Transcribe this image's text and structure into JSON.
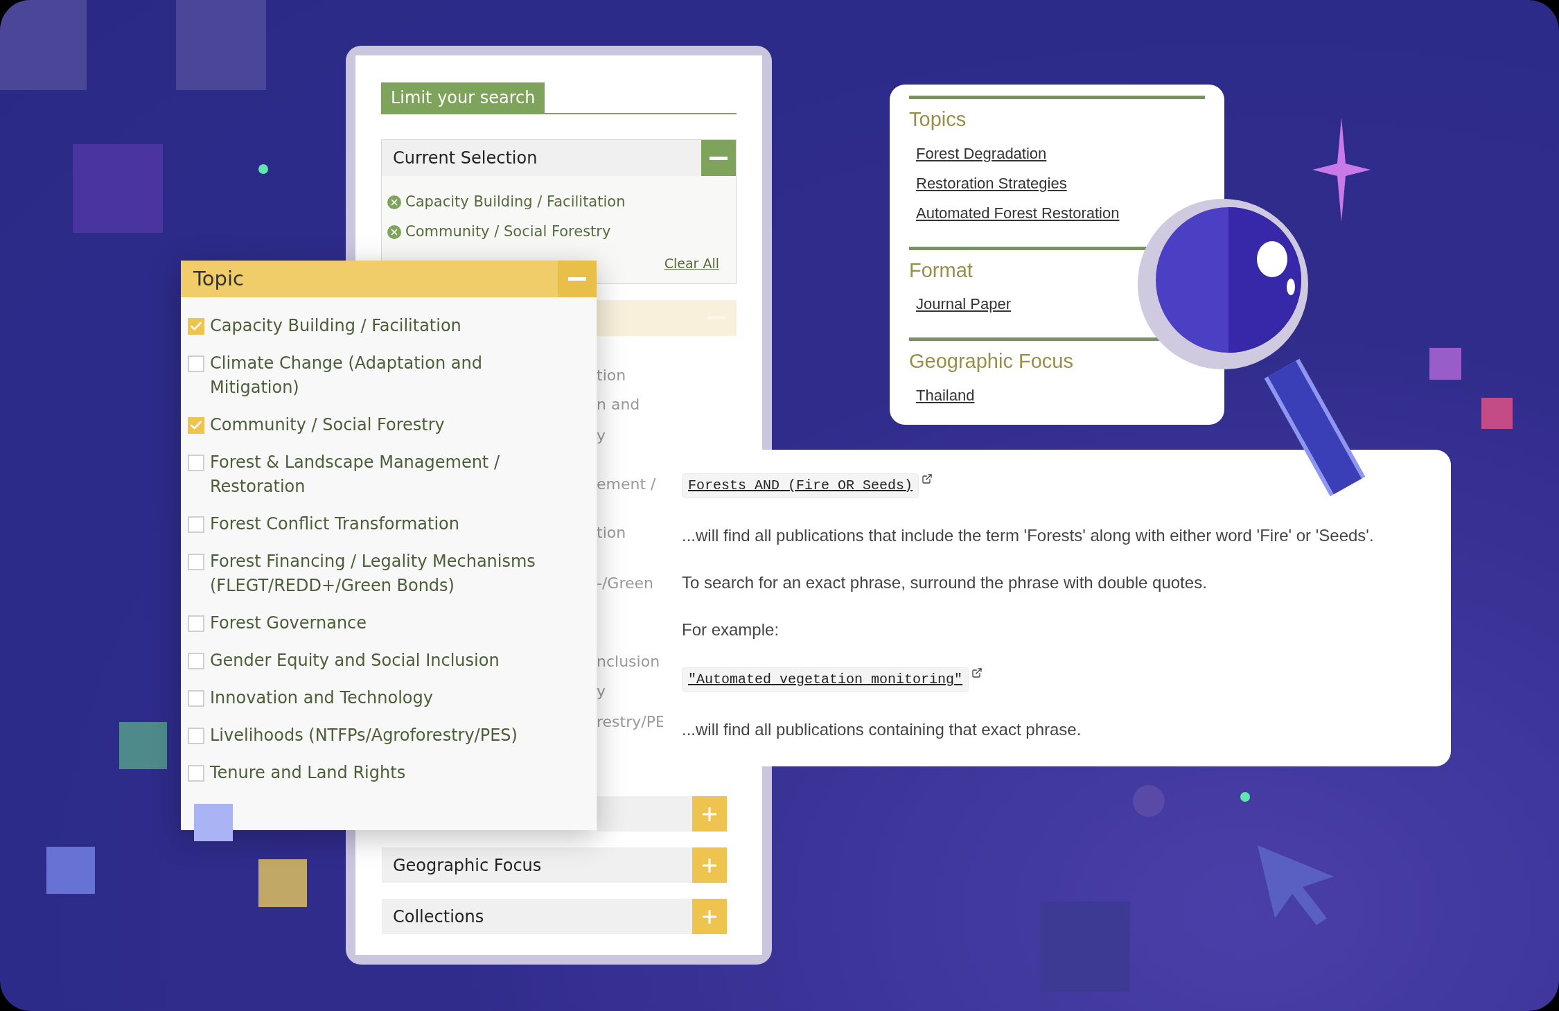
{
  "filter_panel": {
    "title": "Limit your search",
    "current_selection": {
      "title": "Current Selection",
      "expanded": true,
      "items": [
        "Capacity Building / Facilitation",
        "Community / Social Forestry"
      ],
      "clear_label": "Clear All"
    },
    "faded_section": {
      "expanded": true,
      "fragments": [
        "tion",
        "n and",
        "y",
        "ement /",
        "tion",
        "-/Green",
        "nclusion",
        "y",
        "restry/PE"
      ]
    },
    "sections": [
      {
        "expanded": false
      },
      {
        "title": "Geographic Focus",
        "expanded": false
      },
      {
        "title": "Collections",
        "expanded": false
      }
    ]
  },
  "topic_panel": {
    "title": "Topic",
    "expanded": true,
    "options": [
      {
        "label": "Capacity Building / Facilitation",
        "checked": true
      },
      {
        "label": "Climate Change (Adaptation and Mitigation)",
        "checked": false
      },
      {
        "label": "Community / Social Forestry",
        "checked": true
      },
      {
        "label": "Forest & Landscape Management / Restoration",
        "checked": false
      },
      {
        "label": "Forest Conflict Transformation",
        "checked": false
      },
      {
        "label": "Forest Financing / Legality Mechanisms (FLEGT/REDD+/Green Bonds)",
        "checked": false
      },
      {
        "label": "Forest Governance",
        "checked": false
      },
      {
        "label": "Gender Equity and Social Inclusion",
        "checked": false
      },
      {
        "label": "Innovation and Technology",
        "checked": false
      },
      {
        "label": "Livelihoods (NTFPs/Agroforestry/PES)",
        "checked": false
      },
      {
        "label": "Tenure and Land Rights",
        "checked": false
      }
    ]
  },
  "facets_card": {
    "groups": [
      {
        "title": "Topics",
        "links": [
          "Forest Degradation",
          "Restoration Strategies",
          "Automated Forest Restoration"
        ]
      },
      {
        "title": "Format",
        "links": [
          "Journal Paper"
        ]
      },
      {
        "title": "Geographic Focus",
        "links": [
          "Thailand"
        ]
      }
    ]
  },
  "search_help": {
    "blocks": [
      {
        "kind": "code",
        "text": "Forests AND (Fire OR Seeds)"
      },
      {
        "kind": "text",
        "text": "...will find all publications that include the term 'Forests' along with either word 'Fire' or 'Seeds'."
      },
      {
        "kind": "text",
        "text": "To search for an exact phrase, surround the phrase with double quotes."
      },
      {
        "kind": "text",
        "text": "For example:"
      },
      {
        "kind": "code",
        "text": "\"Automated vegetation monitoring\""
      },
      {
        "kind": "text",
        "text": "...will find all publications containing that exact phrase."
      }
    ]
  }
}
